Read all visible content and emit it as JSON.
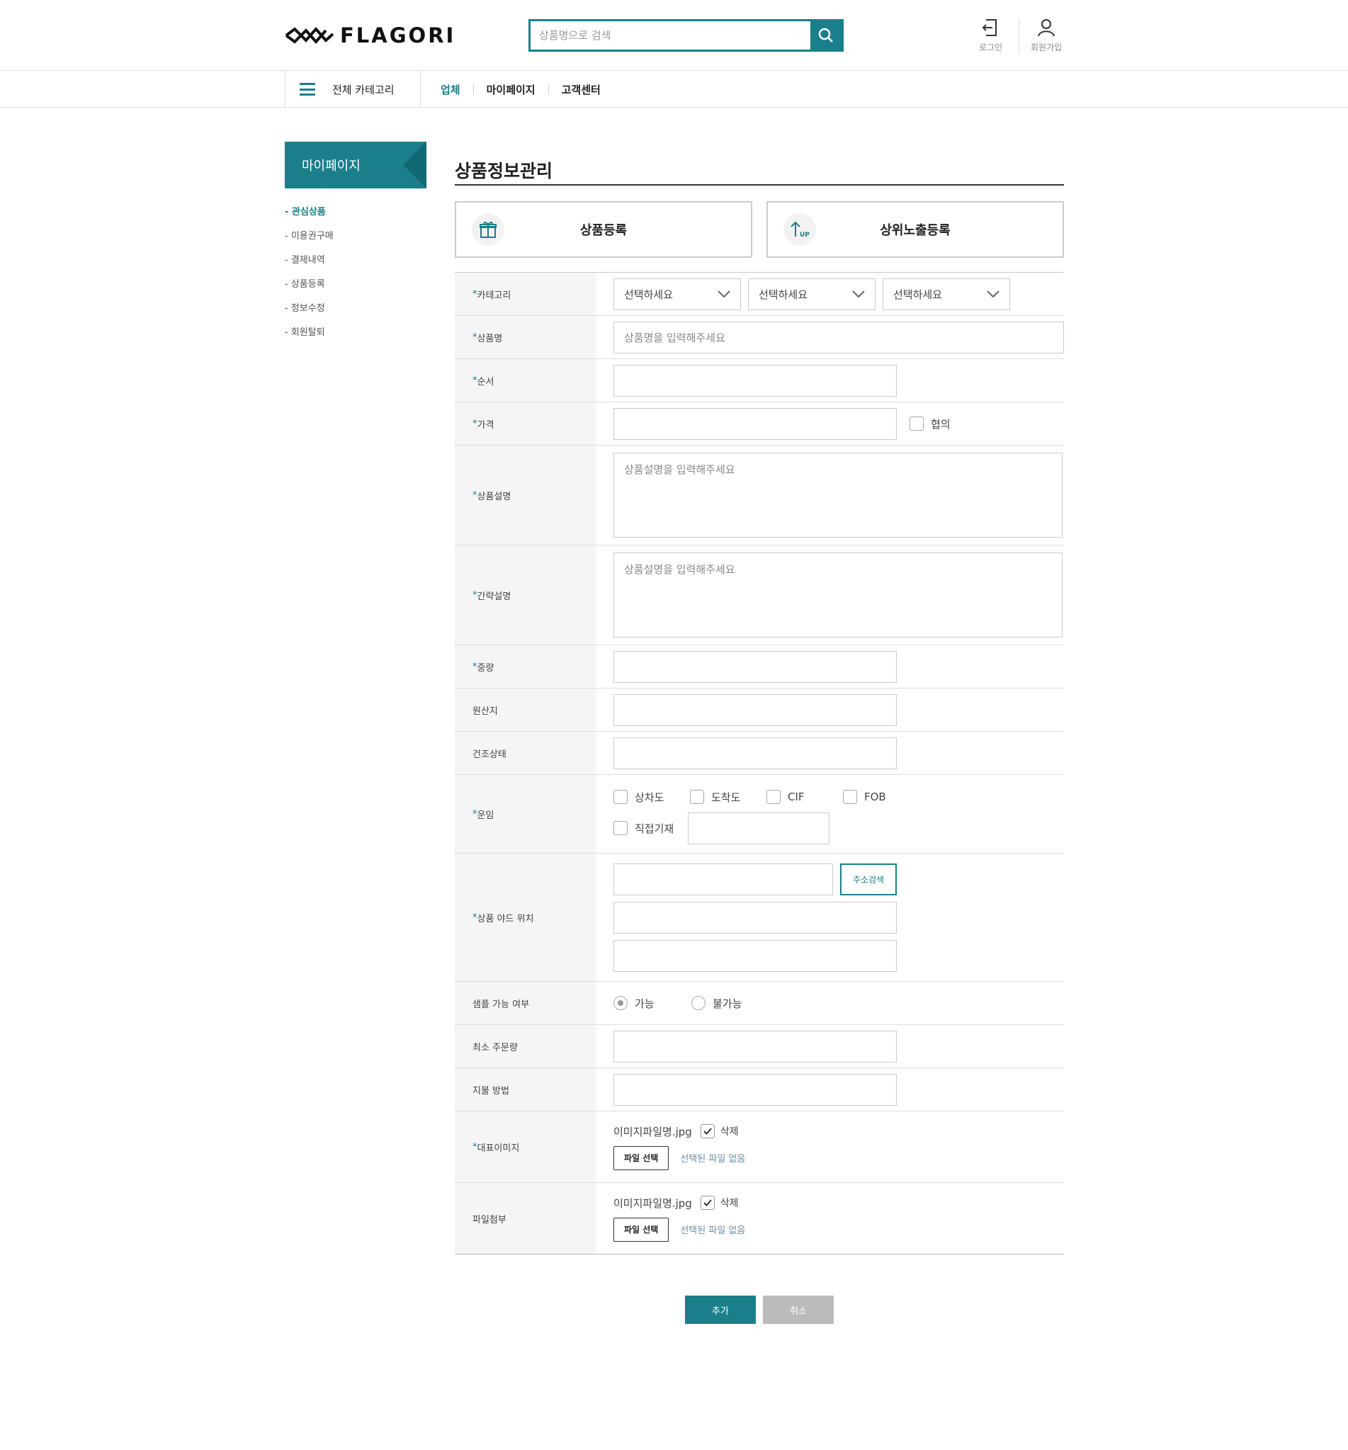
{
  "brand": {
    "logo_text": "FLAGORI",
    "accent": "#1a7f8a"
  },
  "search": {
    "placeholder": "상품명으로 검색"
  },
  "utility": {
    "login": "로그인",
    "signup": "회원가입"
  },
  "nav": {
    "all_category": "전체 카테고리",
    "links": [
      "업체",
      "마이페이지",
      "고객센터"
    ]
  },
  "sidebar": {
    "title": "마이페이지",
    "items": [
      "- 관심상품",
      "- 이용권구매",
      "- 결제내역",
      "- 상품등록",
      "- 정보수정",
      "- 회원탈퇴"
    ]
  },
  "main": {
    "title": "상품정보관리",
    "tabs": [
      {
        "label": "상품등록",
        "icon": "gift-icon"
      },
      {
        "label": "상위노출등록",
        "icon": "up-arrow-icon"
      }
    ]
  },
  "form": {
    "required_mark": "*",
    "labels": {
      "category": "카테고리",
      "name": "상품명",
      "order": "순서",
      "price": "가격",
      "desc": "상품설명",
      "short_desc": "간략설명",
      "weight": "중량",
      "origin": "원산지",
      "dry": "건조상태",
      "freight": "운임",
      "location": "상품 야드 위치",
      "sample": "샘플 가능 여부",
      "min_order": "최소 주문량",
      "payment": "지불 방법",
      "main_image": "대표이미지",
      "attachment": "파일첨부"
    },
    "select_placeholder": "선택하세요",
    "name_placeholder": "상품명을 입력해주세요",
    "desc_placeholder": "상품설명을 입력해주세요",
    "negotiable": "협의",
    "freight_options": [
      "상차도",
      "도착도",
      "CIF",
      "FOB"
    ],
    "freight_direct": "직접기재",
    "address_search": "주소검색",
    "sample_options": [
      "가능",
      "불가능"
    ],
    "file_name": "이미지파일명.jpg",
    "delete_label": "삭제",
    "file_button": "파일 선택",
    "no_file": "선택된 파일 없음"
  },
  "actions": {
    "add": "추가",
    "cancel": "취소"
  }
}
